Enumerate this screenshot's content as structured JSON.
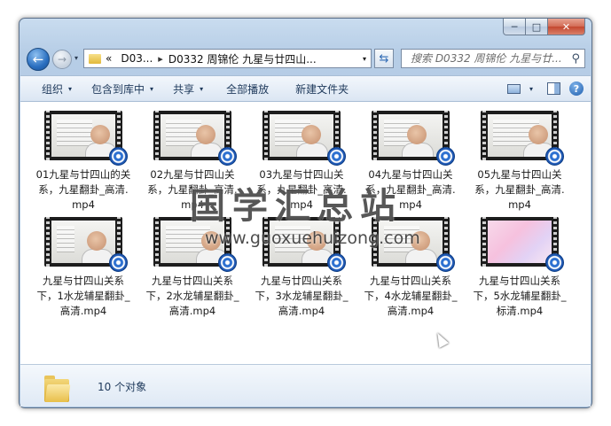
{
  "window": {
    "caption": {
      "minimize": "─",
      "maximize": "□",
      "close": "✕"
    }
  },
  "nav": {
    "back": "←",
    "forward": "→",
    "history_drop": "▾",
    "breadcrumb": {
      "overflow": "«",
      "crumb1": "D03...",
      "crumb2": "D0332 周锦伦 九星与廿四山...",
      "separator": "▸",
      "drop": "▾"
    },
    "refresh": "⇆"
  },
  "search": {
    "placeholder": "搜索 D0332 周锦伦 九星与廿...",
    "icon": "⚲"
  },
  "toolbar": {
    "organize": "组织",
    "include_library": "包含到库中",
    "share": "共享",
    "play_all": "全部播放",
    "new_folder": "新建文件夹",
    "caret": "▾",
    "help": "?"
  },
  "files": [
    {
      "name": "01九星与廿四山的关系，九星翻卦_高清.mp4"
    },
    {
      "name": "02九星与廿四山关系，九星翻卦_高清.mp4"
    },
    {
      "name": "03九星与廿四山关系，九星翻卦_高清.mp4"
    },
    {
      "name": "04九星与廿四山关系，九星翻卦_高清.mp4"
    },
    {
      "name": "05九星与廿四山关系，九星翻卦_高清.mp4"
    },
    {
      "name": "九星与廿四山关系下，1水龙辅星翻卦_高清.mp4"
    },
    {
      "name": "九星与廿四山关系下，2水龙辅星翻卦_高清.mp4"
    },
    {
      "name": "九星与廿四山关系下，3水龙辅星翻卦_高清.mp4"
    },
    {
      "name": "九星与廿四山关系下，4水龙辅星翻卦_高清.mp4"
    },
    {
      "name": "九星与廿四山关系下，5水龙辅星翻卦_标清.mp4"
    }
  ],
  "watermark": {
    "title": "国学汇总站",
    "url": "www.guoxuehuizong.com"
  },
  "details": {
    "count": "10 个对象"
  }
}
